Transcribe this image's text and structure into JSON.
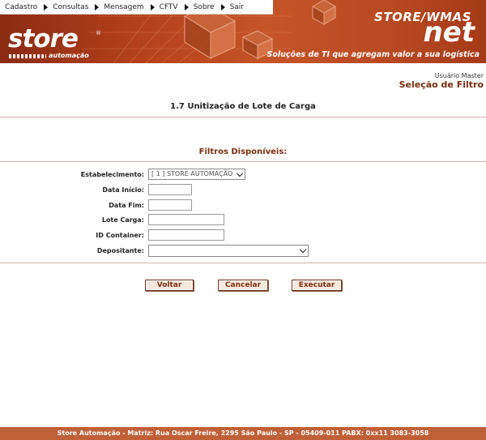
{
  "menu": [
    {
      "label": "Cadastro"
    },
    {
      "label": "Consultas"
    },
    {
      "label": "Mensagem"
    },
    {
      "label": "CFTV"
    },
    {
      "label": "Sobre"
    },
    {
      "label": "Sair"
    }
  ],
  "brand": {
    "logo": "store",
    "logo_reg": "®",
    "logo_sub": "automação",
    "product": "STORE/WMAS",
    "product_sub": "net",
    "slogan": "Soluções de TI que agregam valor a sua logística"
  },
  "user": {
    "name": "Usuário Master",
    "screen": "Seleção de Filtro"
  },
  "page": {
    "title": "1.7 Unitização de Lote de Carga",
    "filters_title": "Filtros Disponíveis:"
  },
  "form": {
    "estabelecimento": {
      "label": "Estabelecimento:",
      "value": "[ 1 ] STORE AUTOMAÇÃO"
    },
    "data_inicio": {
      "label": "Data Início:",
      "value": ""
    },
    "data_fim": {
      "label": "Data Fim:",
      "value": ""
    },
    "lote_carga": {
      "label": "Lote Carga:",
      "value": ""
    },
    "id_container": {
      "label": "ID Container:",
      "value": ""
    },
    "depositante": {
      "label": "Depositante:",
      "value": ""
    }
  },
  "buttons": {
    "voltar": "Voltar",
    "cancelar": "Cancelar",
    "executar": "Executar"
  },
  "footer": "Store Automação - Matriz: Rua Oscar Freire, 2295 São Paulo - SP - 05409-011 PABX: 0xx11 3083-3058",
  "colors": {
    "banner": "#b6421c",
    "accent": "#7a2e0e",
    "footer": "#c06038"
  }
}
